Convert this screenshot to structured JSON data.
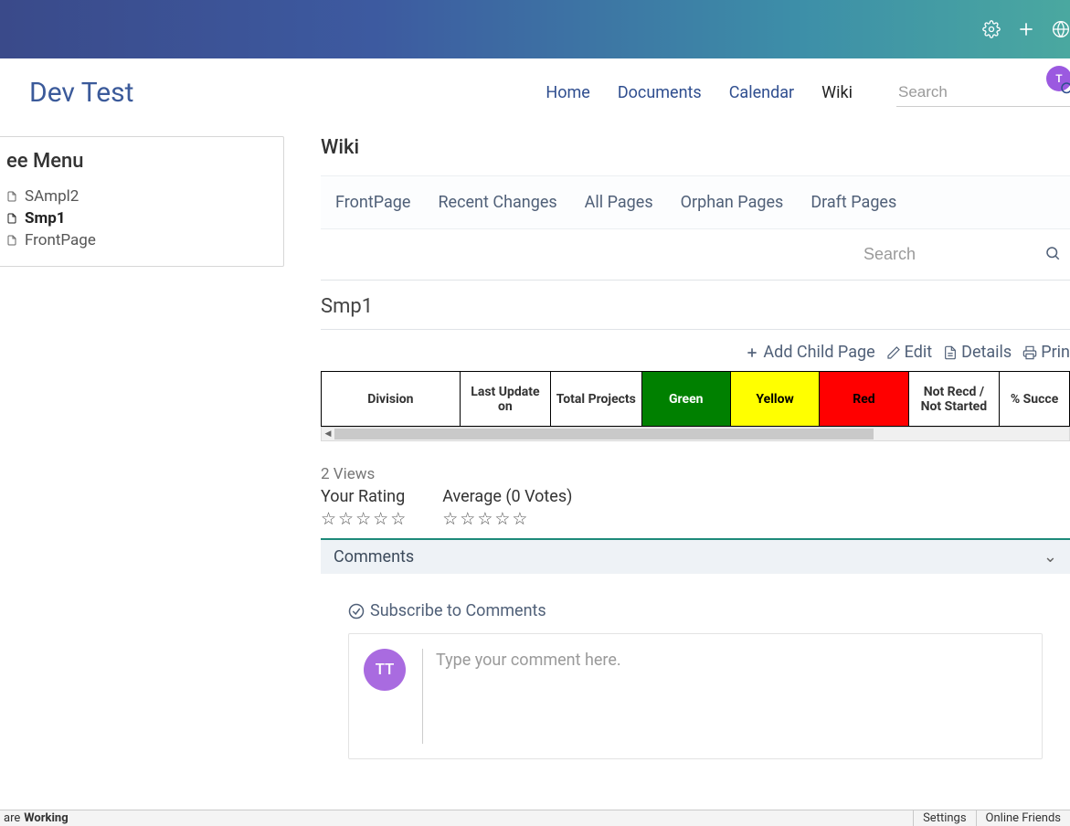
{
  "topbar": {
    "icons": [
      "gear",
      "plus",
      "globe"
    ]
  },
  "header": {
    "site_title": "Dev Test",
    "nav": {
      "home": "Home",
      "documents": "Documents",
      "calendar": "Calendar",
      "wiki": "Wiki"
    },
    "search_placeholder": "Search",
    "avatar_initials": "T"
  },
  "sidebar": {
    "title": "ee Menu",
    "items": [
      {
        "label": "SAmpl2",
        "active": false
      },
      {
        "label": "Smp1",
        "active": true
      },
      {
        "label": "FrontPage",
        "active": false
      }
    ]
  },
  "wiki": {
    "title": "Wiki",
    "tabs": {
      "frontpage": "FrontPage",
      "recent": "Recent Changes",
      "all": "All Pages",
      "orphan": "Orphan Pages",
      "draft": "Draft Pages"
    },
    "search_placeholder": "Search",
    "page_name": "Smp1",
    "actions": {
      "add_child": "Add Child Page",
      "edit": "Edit",
      "details": "Details",
      "print": "Prin"
    },
    "table_headers": {
      "division": "Division",
      "last_update": "Last Update on",
      "total_projects": "Total Projects",
      "green": "Green",
      "yellow": "Yellow",
      "red": "Red",
      "not_recd": "Not Recd / Not Started",
      "pct_success": "% Succe"
    },
    "views_text": "2 Views",
    "rating": {
      "your_label": "Your Rating",
      "avg_label": "Average (0 Votes)",
      "your_stars": 0,
      "avg_stars": 0
    },
    "comments": {
      "panel_title": "Comments",
      "subscribe_label": "Subscribe to Comments",
      "avatar_initials": "TT",
      "input_placeholder": "Type your comment here."
    }
  },
  "statusbar": {
    "left_prefix": "are ",
    "left_bold": "Working",
    "settings": "Settings",
    "online": "Online Friends"
  },
  "colors": {
    "green": "#008000",
    "yellow": "#ffff00",
    "red": "#ff0000",
    "brand": "#3b5a9a",
    "accent_teal": "#1d8a7a",
    "avatar_purple": "#a96be0"
  }
}
